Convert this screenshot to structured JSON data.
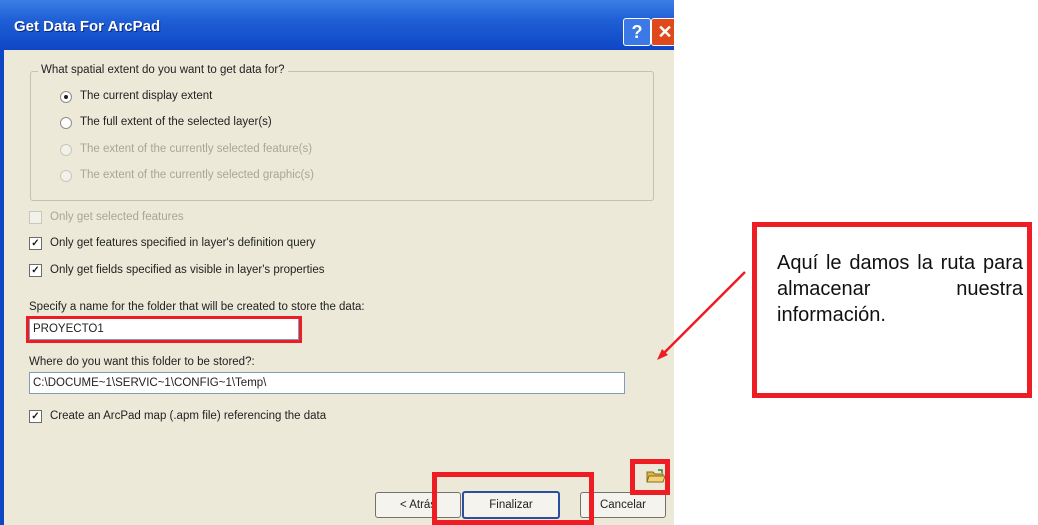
{
  "window": {
    "title": "Get Data For ArcPad",
    "help_glyph": "?",
    "close_glyph": "✕"
  },
  "extent_group": {
    "legend": "What spatial extent do you want to get data for?",
    "options": [
      {
        "label": "The current display extent",
        "selected": true,
        "enabled": true
      },
      {
        "label": "The full extent of the selected layer(s)",
        "selected": false,
        "enabled": true
      },
      {
        "label": "The extent of the currently selected feature(s)",
        "selected": false,
        "enabled": false
      },
      {
        "label": "The extent of the currently selected graphic(s)",
        "selected": false,
        "enabled": false
      }
    ]
  },
  "checkboxes": [
    {
      "label": "Only get selected features",
      "checked": false,
      "enabled": false
    },
    {
      "label": "Only get features specified in layer's definition query",
      "checked": true,
      "enabled": true
    },
    {
      "label": "Only get fields specified as visible in layer's properties",
      "checked": true,
      "enabled": true
    }
  ],
  "folder_name": {
    "label": "Specify a name for the folder that will be created to store the data:",
    "value": "PROYECTO1"
  },
  "folder_location": {
    "label": "Where do you want this folder to be stored?:",
    "value": "C:\\DOCUME~1\\SERVIC~1\\CONFIG~1\\Temp\\"
  },
  "create_map": {
    "label": "Create an ArcPad map (.apm file) referencing the data",
    "checked": true
  },
  "buttons": {
    "back": "< Atrás",
    "finish": "Finalizar",
    "cancel": "Cancelar"
  },
  "annotation": {
    "text": "Aquí le damos la ruta para almacenar nuestra información.",
    "color": "#ee1d23"
  }
}
